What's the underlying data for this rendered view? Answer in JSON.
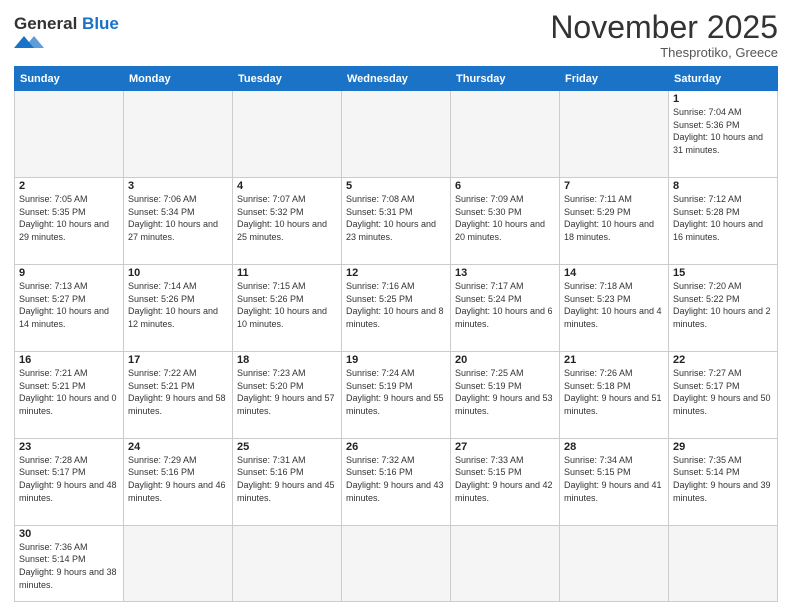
{
  "logo": {
    "text_regular": "General",
    "text_blue": "Blue"
  },
  "header": {
    "month": "November 2025",
    "location": "Thesprotiko, Greece"
  },
  "days_of_week": [
    "Sunday",
    "Monday",
    "Tuesday",
    "Wednesday",
    "Thursday",
    "Friday",
    "Saturday"
  ],
  "weeks": [
    [
      {
        "day": "",
        "info": ""
      },
      {
        "day": "",
        "info": ""
      },
      {
        "day": "",
        "info": ""
      },
      {
        "day": "",
        "info": ""
      },
      {
        "day": "",
        "info": ""
      },
      {
        "day": "",
        "info": ""
      },
      {
        "day": "1",
        "info": "Sunrise: 7:04 AM\nSunset: 5:36 PM\nDaylight: 10 hours and 31 minutes."
      }
    ],
    [
      {
        "day": "2",
        "info": "Sunrise: 7:05 AM\nSunset: 5:35 PM\nDaylight: 10 hours and 29 minutes."
      },
      {
        "day": "3",
        "info": "Sunrise: 7:06 AM\nSunset: 5:34 PM\nDaylight: 10 hours and 27 minutes."
      },
      {
        "day": "4",
        "info": "Sunrise: 7:07 AM\nSunset: 5:32 PM\nDaylight: 10 hours and 25 minutes."
      },
      {
        "day": "5",
        "info": "Sunrise: 7:08 AM\nSunset: 5:31 PM\nDaylight: 10 hours and 23 minutes."
      },
      {
        "day": "6",
        "info": "Sunrise: 7:09 AM\nSunset: 5:30 PM\nDaylight: 10 hours and 20 minutes."
      },
      {
        "day": "7",
        "info": "Sunrise: 7:11 AM\nSunset: 5:29 PM\nDaylight: 10 hours and 18 minutes."
      },
      {
        "day": "8",
        "info": "Sunrise: 7:12 AM\nSunset: 5:28 PM\nDaylight: 10 hours and 16 minutes."
      }
    ],
    [
      {
        "day": "9",
        "info": "Sunrise: 7:13 AM\nSunset: 5:27 PM\nDaylight: 10 hours and 14 minutes."
      },
      {
        "day": "10",
        "info": "Sunrise: 7:14 AM\nSunset: 5:26 PM\nDaylight: 10 hours and 12 minutes."
      },
      {
        "day": "11",
        "info": "Sunrise: 7:15 AM\nSunset: 5:26 PM\nDaylight: 10 hours and 10 minutes."
      },
      {
        "day": "12",
        "info": "Sunrise: 7:16 AM\nSunset: 5:25 PM\nDaylight: 10 hours and 8 minutes."
      },
      {
        "day": "13",
        "info": "Sunrise: 7:17 AM\nSunset: 5:24 PM\nDaylight: 10 hours and 6 minutes."
      },
      {
        "day": "14",
        "info": "Sunrise: 7:18 AM\nSunset: 5:23 PM\nDaylight: 10 hours and 4 minutes."
      },
      {
        "day": "15",
        "info": "Sunrise: 7:20 AM\nSunset: 5:22 PM\nDaylight: 10 hours and 2 minutes."
      }
    ],
    [
      {
        "day": "16",
        "info": "Sunrise: 7:21 AM\nSunset: 5:21 PM\nDaylight: 10 hours and 0 minutes."
      },
      {
        "day": "17",
        "info": "Sunrise: 7:22 AM\nSunset: 5:21 PM\nDaylight: 9 hours and 58 minutes."
      },
      {
        "day": "18",
        "info": "Sunrise: 7:23 AM\nSunset: 5:20 PM\nDaylight: 9 hours and 57 minutes."
      },
      {
        "day": "19",
        "info": "Sunrise: 7:24 AM\nSunset: 5:19 PM\nDaylight: 9 hours and 55 minutes."
      },
      {
        "day": "20",
        "info": "Sunrise: 7:25 AM\nSunset: 5:19 PM\nDaylight: 9 hours and 53 minutes."
      },
      {
        "day": "21",
        "info": "Sunrise: 7:26 AM\nSunset: 5:18 PM\nDaylight: 9 hours and 51 minutes."
      },
      {
        "day": "22",
        "info": "Sunrise: 7:27 AM\nSunset: 5:17 PM\nDaylight: 9 hours and 50 minutes."
      }
    ],
    [
      {
        "day": "23",
        "info": "Sunrise: 7:28 AM\nSunset: 5:17 PM\nDaylight: 9 hours and 48 minutes."
      },
      {
        "day": "24",
        "info": "Sunrise: 7:29 AM\nSunset: 5:16 PM\nDaylight: 9 hours and 46 minutes."
      },
      {
        "day": "25",
        "info": "Sunrise: 7:31 AM\nSunset: 5:16 PM\nDaylight: 9 hours and 45 minutes."
      },
      {
        "day": "26",
        "info": "Sunrise: 7:32 AM\nSunset: 5:16 PM\nDaylight: 9 hours and 43 minutes."
      },
      {
        "day": "27",
        "info": "Sunrise: 7:33 AM\nSunset: 5:15 PM\nDaylight: 9 hours and 42 minutes."
      },
      {
        "day": "28",
        "info": "Sunrise: 7:34 AM\nSunset: 5:15 PM\nDaylight: 9 hours and 41 minutes."
      },
      {
        "day": "29",
        "info": "Sunrise: 7:35 AM\nSunset: 5:14 PM\nDaylight: 9 hours and 39 minutes."
      }
    ],
    [
      {
        "day": "30",
        "info": "Sunrise: 7:36 AM\nSunset: 5:14 PM\nDaylight: 9 hours and 38 minutes."
      },
      {
        "day": "",
        "info": ""
      },
      {
        "day": "",
        "info": ""
      },
      {
        "day": "",
        "info": ""
      },
      {
        "day": "",
        "info": ""
      },
      {
        "day": "",
        "info": ""
      },
      {
        "day": "",
        "info": ""
      }
    ]
  ]
}
